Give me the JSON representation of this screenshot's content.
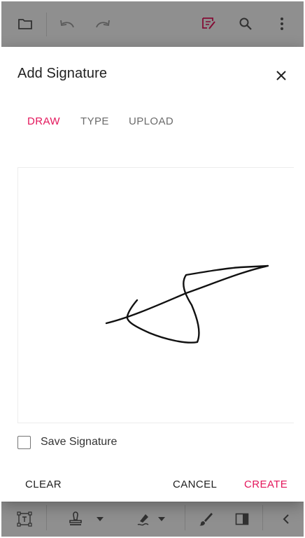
{
  "dialog": {
    "title": "Add Signature",
    "tabs": [
      {
        "label": "DRAW",
        "active": true
      },
      {
        "label": "TYPE",
        "active": false
      },
      {
        "label": "UPLOAD",
        "active": false
      }
    ],
    "save_label": "Save Signature",
    "save_checked": false,
    "actions": {
      "clear": "CLEAR",
      "cancel": "CANCEL",
      "create": "CREATE"
    }
  },
  "top_toolbar": {
    "icons": [
      "folder-icon",
      "undo-icon",
      "redo-icon",
      "annotation-edit-icon",
      "search-icon",
      "more-vertical-icon"
    ]
  },
  "bottom_toolbar": {
    "icons": [
      "text-box-icon",
      "stamp-icon",
      "dropdown-icon",
      "signature-pen-icon",
      "dropdown-icon",
      "ink-brush-icon",
      "panel-toggle-icon",
      "chevron-left-icon"
    ]
  },
  "colors": {
    "accent": "#e3165b",
    "text": "#212121",
    "muted": "#6b6b6b"
  }
}
